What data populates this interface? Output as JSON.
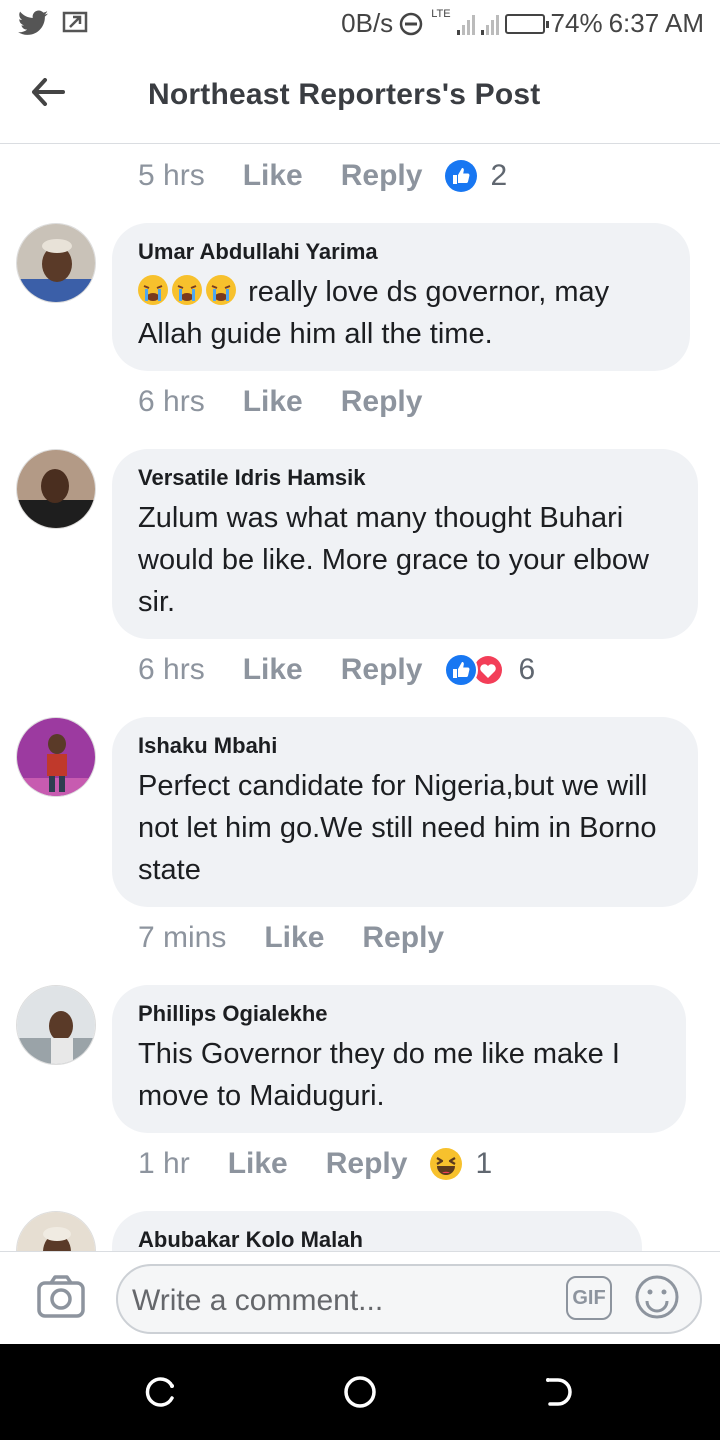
{
  "status_bar": {
    "network_speed": "0B/s",
    "network_type": "LTE",
    "battery": "74%",
    "battery_level": 0.74,
    "time": "6:37 AM"
  },
  "header": {
    "title": "Northeast Reporters's Post"
  },
  "top_meta": {
    "time": "5 hrs",
    "like": "Like",
    "reply": "Reply",
    "reaction_count": "2"
  },
  "comments": [
    {
      "author": "Umar Abdullahi Yarima",
      "text": "really love ds governor, may Allah guide him all the time.",
      "emoji_prefix": "crying-face-emoji x3",
      "time": "6 hrs",
      "like": "Like",
      "reply": "Reply",
      "reaction_count": ""
    },
    {
      "author": "Versatile Idris Hamsik",
      "text": "Zulum was what many thought Buhari would be like. More grace to your elbow sir.",
      "time": "6 hrs",
      "like": "Like",
      "reply": "Reply",
      "reaction_count": "6"
    },
    {
      "author": "Ishaku Mbahi",
      "text": "Perfect candidate for Nigeria,but we will not let him go.We still need him in Borno state",
      "time": "7 mins",
      "like": "Like",
      "reply": "Reply",
      "reaction_count": ""
    },
    {
      "author": "Phillips Ogialekhe",
      "text": "This Governor they do me like make I move to Maiduguri.",
      "time": "1 hr",
      "like": "Like",
      "reply": "Reply",
      "reaction_count": "1"
    },
    {
      "author": "Abubakar Kolo Malah"
    }
  ],
  "composer": {
    "placeholder": "Write a comment...",
    "gif_label": "GIF"
  },
  "colors": {
    "fb_blue": "#1877f2",
    "bubble_bg": "#f0f2f5",
    "meta_gray": "#8d949e",
    "love_red": "#f33e58"
  }
}
